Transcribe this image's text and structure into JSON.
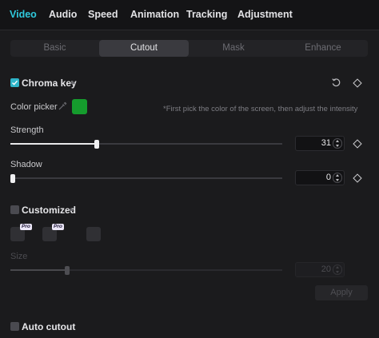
{
  "top_tabs": [
    {
      "label": "Video",
      "active": true
    },
    {
      "label": "Audio",
      "active": false
    },
    {
      "label": "Speed",
      "active": false
    },
    {
      "label": "Animation",
      "active": false
    },
    {
      "label": "Tracking",
      "active": false
    },
    {
      "label": "Adjustment",
      "active": false
    }
  ],
  "sub_tabs": [
    {
      "label": "Basic",
      "active": false
    },
    {
      "label": "Cutout",
      "active": true
    },
    {
      "label": "Mask",
      "active": false
    },
    {
      "label": "Enhance",
      "active": false
    }
  ],
  "chroma_key": {
    "title": "Chroma key",
    "checked": true,
    "color_picker_label": "Color picker",
    "picked_color": "#159c2d",
    "hint": "*First pick the color of the screen, then adjust the intensity",
    "strength": {
      "label": "Strength",
      "value": "31",
      "fraction": 0.31
    },
    "shadow": {
      "label": "Shadow",
      "value": "0",
      "fraction": 0.0
    }
  },
  "customized": {
    "title": "Customized",
    "checked": false,
    "presets": [
      {
        "badge": "Pro"
      },
      {
        "badge": "Pro"
      },
      {
        "badge": ""
      }
    ],
    "size": {
      "label": "Size",
      "value": "20",
      "fraction": 0.2
    },
    "apply_label": "Apply"
  },
  "auto_cutout": {
    "title": "Auto cutout",
    "checked": false
  },
  "colors": {
    "accent": "#2fc9dc",
    "checkbox": "#2fb5c9",
    "background": "#1b1b1d"
  },
  "icons": {
    "reset": "reset-icon",
    "keyframe": "keyframe-icon",
    "eyedropper": "eyedropper-icon"
  }
}
